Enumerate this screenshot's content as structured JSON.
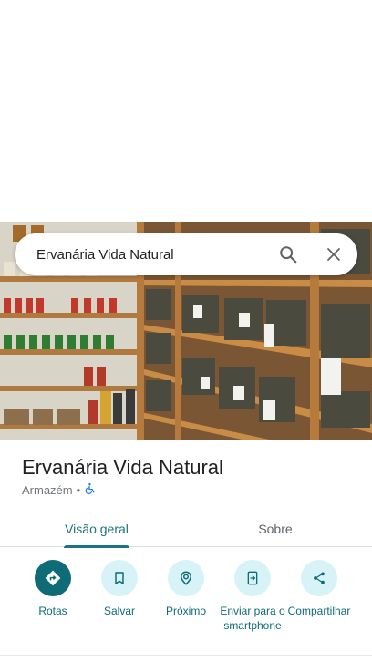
{
  "search": {
    "query": "Ervanária Vida Natural",
    "search_icon": "search-icon",
    "close_icon": "close-icon"
  },
  "place": {
    "name": "Ervanária Vida Natural",
    "category": "Armazém",
    "separator": "•",
    "accessibility_icon": "wheelchair-icon"
  },
  "tabs": [
    {
      "label": "Visão geral",
      "selected": true
    },
    {
      "label": "Sobre",
      "selected": false
    }
  ],
  "actions": [
    {
      "label": "Rotas",
      "icon": "directions-icon"
    },
    {
      "label": "Salvar",
      "icon": "bookmark-icon"
    },
    {
      "label": "Próximo",
      "icon": "nearby-icon"
    },
    {
      "label": "Enviar para o smartphone",
      "icon": "send-to-phone-icon"
    },
    {
      "label": "Compartilhar",
      "icon": "share-icon"
    }
  ],
  "colors": {
    "accent": "#1a737e",
    "action_bg": "#d7f3f7",
    "primary_action_bg": "#0f6b75"
  }
}
